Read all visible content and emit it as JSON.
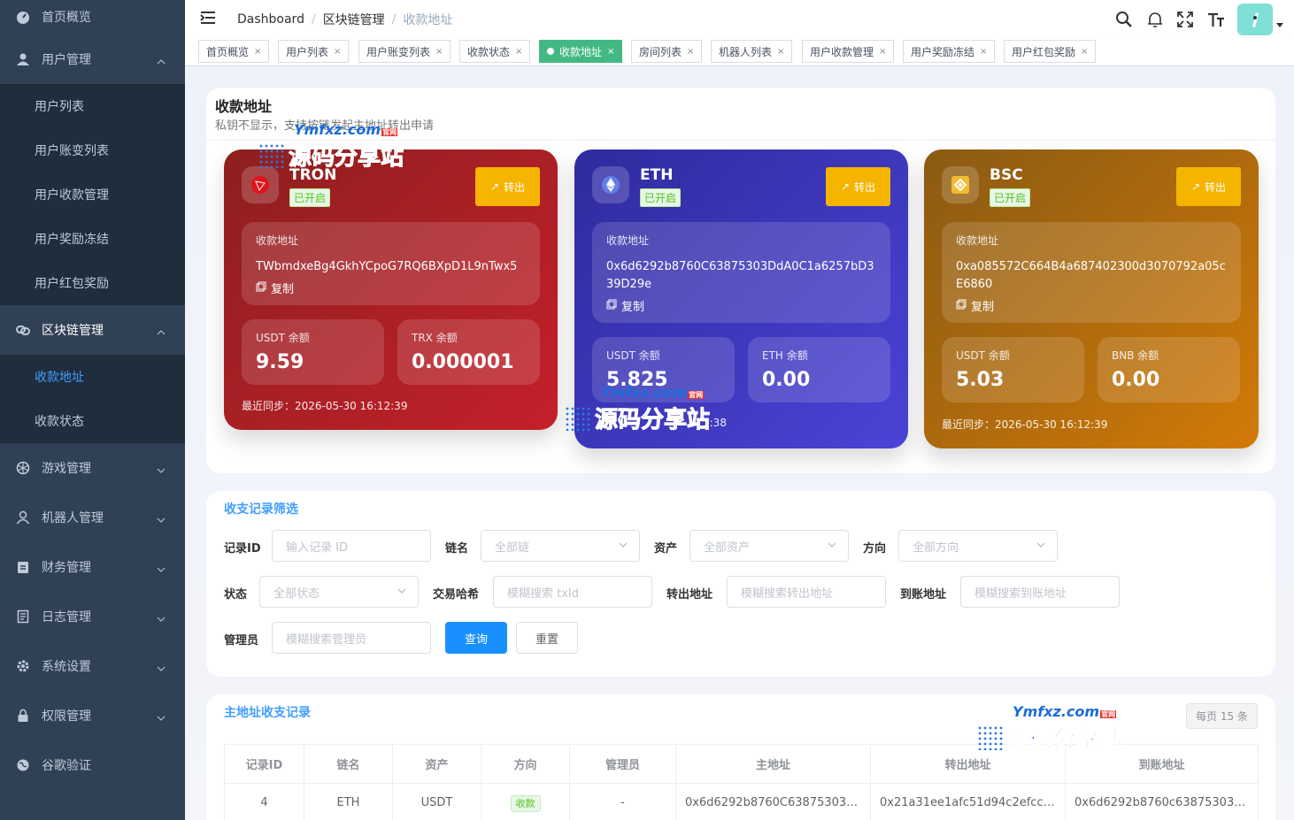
{
  "sidebar": {
    "items": [
      {
        "label": "首页概览"
      },
      {
        "label": "用户管理"
      },
      {
        "label": "区块链管理"
      },
      {
        "label": "游戏管理"
      },
      {
        "label": "机器人管理"
      },
      {
        "label": "财务管理"
      },
      {
        "label": "日志管理"
      },
      {
        "label": "系统设置"
      },
      {
        "label": "权限管理"
      },
      {
        "label": "谷歌验证"
      }
    ],
    "user_sub": [
      "用户列表",
      "用户账变列表",
      "用户收款管理",
      "用户奖励冻结",
      "用户红包奖励"
    ],
    "chain_sub": [
      "收款地址",
      "收款状态"
    ]
  },
  "breadcrumb": [
    "Dashboard",
    "区块链管理",
    "收款地址"
  ],
  "tags": [
    "首页概览",
    "用户列表",
    "用户账变列表",
    "收款状态",
    "收款地址",
    "房间列表",
    "机器人列表",
    "用户收款管理",
    "用户奖励冻结",
    "用户红包奖励"
  ],
  "page": {
    "title": "收款地址",
    "subtitle": "私钥不显示，支持按链发起主地址转出申请"
  },
  "cards": [
    {
      "chain": "TRON",
      "status": "已开启",
      "out_label": "转出",
      "addr_label": "收款地址",
      "address": "TWbmdxeBg4GkhYCpoG7RQ6BXpD1L9nTwx5",
      "copy": "复制",
      "bal1_label": "USDT 余额",
      "bal1": "9.59",
      "bal2_label": "TRX 余额",
      "bal2": "0.000001",
      "sync": "最近同步：2026-05-30 16:12:39",
      "color": "#b41f25"
    },
    {
      "chain": "ETH",
      "status": "已开启",
      "out_label": "转出",
      "addr_label": "收款地址",
      "address": "0x6d6292b8760C63875303DdA0C1a6257bD339D29e",
      "copy": "复制",
      "bal1_label": "USDT 余额",
      "bal1": "5.825",
      "bal2_label": "ETH 余额",
      "bal2": "0.00",
      "sync": "最近同步：2026-05-30 16:12:39",
      "sync_visible": "7:38",
      "color": "#3f35c8"
    },
    {
      "chain": "BSC",
      "status": "已开启",
      "out_label": "转出",
      "addr_label": "收款地址",
      "address": "0xa085572C664B4a687402300d3070792a05cE6860",
      "copy": "复制",
      "bal1_label": "USDT 余额",
      "bal1": "5.03",
      "bal2_label": "BNB 余额",
      "bal2": "0.00",
      "sync": "最近同步：2026-05-30 16:12:39",
      "color": "#b36b0e"
    }
  ],
  "filter": {
    "title": "收支记录筛选",
    "id_label": "记录ID",
    "id_ph": "输入记录 ID",
    "chain_label": "链名",
    "chain_ph": "全部链",
    "asset_label": "资产",
    "asset_ph": "全部资产",
    "dir_label": "方向",
    "dir_ph": "全部方向",
    "status_label": "状态",
    "status_ph": "全部状态",
    "tx_label": "交易哈希",
    "tx_ph": "模糊搜索 txId",
    "from_label": "转出地址",
    "from_ph": "模糊搜索转出地址",
    "to_label": "到账地址",
    "to_ph": "模糊搜索到账地址",
    "admin_label": "管理员",
    "admin_ph": "模糊搜索管理员",
    "query": "查询",
    "reset": "重置"
  },
  "records": {
    "title": "主地址收支记录",
    "page_size": "每页 15 条",
    "headers": [
      "记录ID",
      "链名",
      "资产",
      "方向",
      "管理员",
      "主地址",
      "转出地址",
      "到账地址"
    ],
    "rows": [
      {
        "id": "4",
        "chain": "ETH",
        "asset": "USDT",
        "dir": "收款",
        "admin": "-",
        "main": "0x6d6292b8760C63875303D…",
        "from": "0x21a31ee1afc51d94c2efcca…",
        "to": "0x6d6292b8760c63875303d…"
      }
    ]
  },
  "watermark": {
    "t1": "Ymfxz.com",
    "badge": "官网",
    "t2": "源码分享站"
  }
}
